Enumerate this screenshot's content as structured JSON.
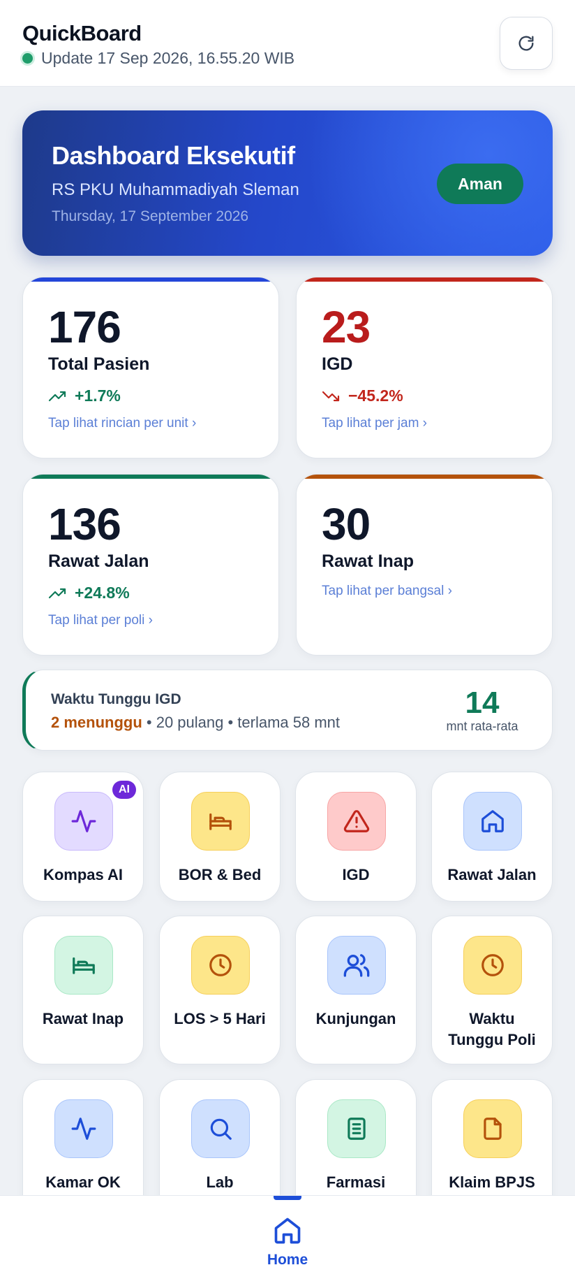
{
  "header": {
    "title": "QuickBoard",
    "update_text": "Update 17 Sep 2026, 16.55.20 WIB",
    "refresh_icon": "refresh-icon"
  },
  "hero": {
    "title": "Dashboard Eksekutif",
    "hospital": "RS PKU Muhammadiyah Sleman",
    "date": "Thursday, 17 September 2026",
    "status_badge": "Aman"
  },
  "stats": [
    {
      "value": "176",
      "label": "Total Pasien",
      "trend": "+1.7%",
      "trend_dir": "up",
      "link": "Tap lihat rincian per unit ›",
      "accent": "#2346d9",
      "value_color": "#0f172a"
    },
    {
      "value": "23",
      "label": "IGD",
      "trend": "−45.2%",
      "trend_dir": "down",
      "link": "Tap lihat per jam ›",
      "accent": "#c2261c",
      "value_color": "#b91c1c"
    },
    {
      "value": "136",
      "label": "Rawat Jalan",
      "trend": "+24.8%",
      "trend_dir": "up",
      "link": "Tap lihat per poli ›",
      "accent": "#0f7a58",
      "value_color": "#0f172a"
    },
    {
      "value": "30",
      "label": "Rawat Inap",
      "trend": "",
      "trend_dir": "none",
      "link": "Tap lihat per bangsal ›",
      "accent": "#b4520b",
      "value_color": "#0f172a"
    }
  ],
  "wait": {
    "title": "Waktu Tunggu IGD",
    "waiting": "2 menunggu",
    "detail": "• 20 pulang • terlama 58 mnt",
    "value": "14",
    "unit": "mnt rata-rata"
  },
  "tiles": [
    {
      "label": "Kompas AI",
      "icon": "activity-icon",
      "color": "violet",
      "badge": "AI"
    },
    {
      "label": "BOR & Bed",
      "icon": "bed-icon",
      "color": "yellow"
    },
    {
      "label": "IGD",
      "icon": "alert-triangle-icon",
      "color": "red"
    },
    {
      "label": "Rawat Jalan",
      "icon": "home-icon",
      "color": "blue"
    },
    {
      "label": "Rawat Inap",
      "icon": "bed-icon",
      "color": "green"
    },
    {
      "label": "LOS > 5 Hari",
      "icon": "clock-icon",
      "color": "yellow"
    },
    {
      "label": "Kunjungan",
      "icon": "users-icon",
      "color": "blue"
    },
    {
      "label": "Waktu Tunggu Poli",
      "icon": "clock-icon",
      "color": "yellow"
    },
    {
      "label": "Kamar OK",
      "icon": "activity-icon",
      "color": "blue"
    },
    {
      "label": "Lab",
      "icon": "search-icon",
      "color": "blue"
    },
    {
      "label": "Farmasi",
      "icon": "clipboard-icon",
      "color": "green"
    },
    {
      "label": "Klaim BPJS",
      "icon": "file-icon",
      "color": "yellow"
    }
  ],
  "nav": {
    "home_label": "Home",
    "home_icon": "home-icon"
  },
  "colors": {
    "primary": "#1d4ed8",
    "success": "#0f7a58",
    "danger": "#b91c1c",
    "warning": "#b4520b"
  }
}
